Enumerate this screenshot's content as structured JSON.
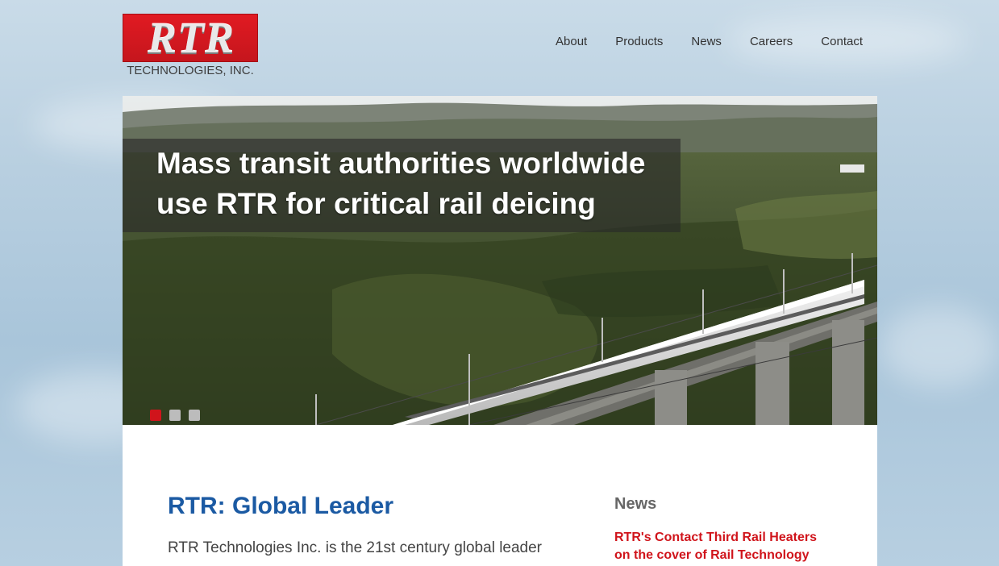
{
  "header": {
    "logo_mark": "RTR",
    "logo_sub": "TECHNOLOGIES, INC.",
    "nav": [
      "About",
      "Products",
      "News",
      "Careers",
      "Contact"
    ]
  },
  "hero": {
    "headline": "Mass transit authorities worldwide use RTR for critical rail deicing",
    "slides_total": 3,
    "slide_active": 1
  },
  "main": {
    "title": "RTR: Global Leader",
    "text": "RTR Technologies Inc. is the 21st century global leader"
  },
  "news": {
    "heading": "News",
    "item": "RTR's Contact Third Rail Heaters on the cover of Rail Technology"
  },
  "colors": {
    "brand_red": "#d0141b",
    "title_blue": "#1b5aa3"
  }
}
